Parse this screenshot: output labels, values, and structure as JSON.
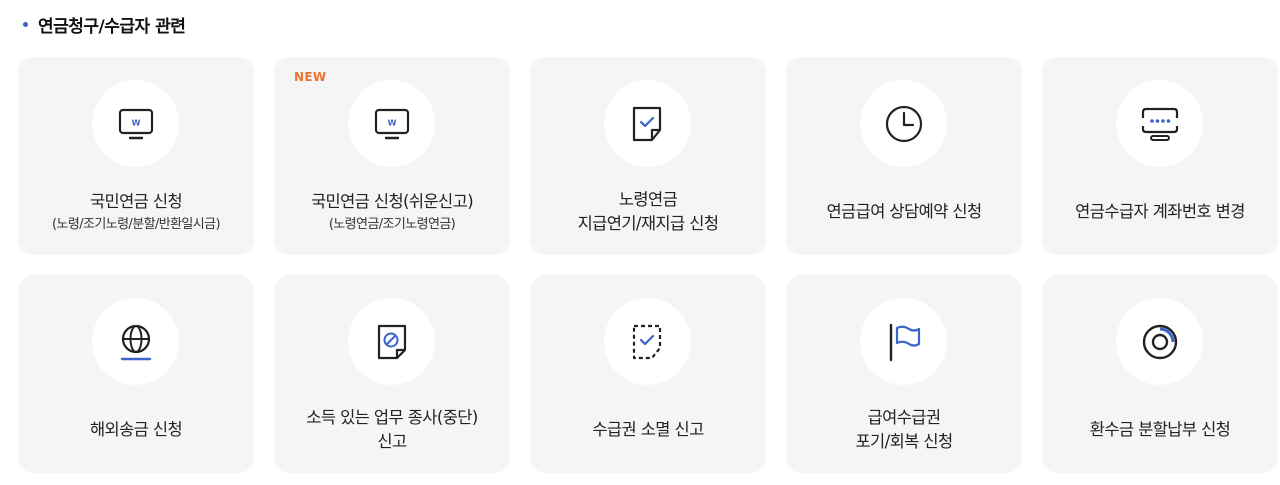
{
  "section": {
    "title": "연금청구/수급자 관련"
  },
  "colors": {
    "accent": "#3a64c8",
    "new_badge": "#f0722e",
    "card_bg": "#f5f5f5"
  },
  "cards": [
    {
      "icon": "monitor-won-icon",
      "label": "국민연금 신청",
      "sublabel": "(노령/조기노령/분할/반환일시금)",
      "badge": ""
    },
    {
      "icon": "monitor-won-icon",
      "label": "국민연금 신청(쉬운신고)",
      "sublabel": "(노령연금/조기노령연금)",
      "badge": "NEW"
    },
    {
      "icon": "document-check-icon",
      "label": "노령연금\n지급연기/재지급 신청",
      "sublabel": "",
      "badge": ""
    },
    {
      "icon": "clock-icon",
      "label": "연금급여 상담예약 신청",
      "sublabel": "",
      "badge": ""
    },
    {
      "icon": "account-password-icon",
      "label": "연금수급자 계좌번호 변경",
      "sublabel": "",
      "badge": ""
    },
    {
      "icon": "globe-icon",
      "label": "해외송금 신청",
      "sublabel": "",
      "badge": ""
    },
    {
      "icon": "document-prohibited-icon",
      "label": "소득 있는 업무 종사(중단)\n신고",
      "sublabel": "",
      "badge": ""
    },
    {
      "icon": "dashed-document-check-icon",
      "label": "수급권 소멸 신고",
      "sublabel": "",
      "badge": ""
    },
    {
      "icon": "flag-icon",
      "label": "급여수급권\n포기/회복 신청",
      "sublabel": "",
      "badge": ""
    },
    {
      "icon": "ring-refund-icon",
      "label": "환수금 분할납부 신청",
      "sublabel": "",
      "badge": ""
    }
  ]
}
